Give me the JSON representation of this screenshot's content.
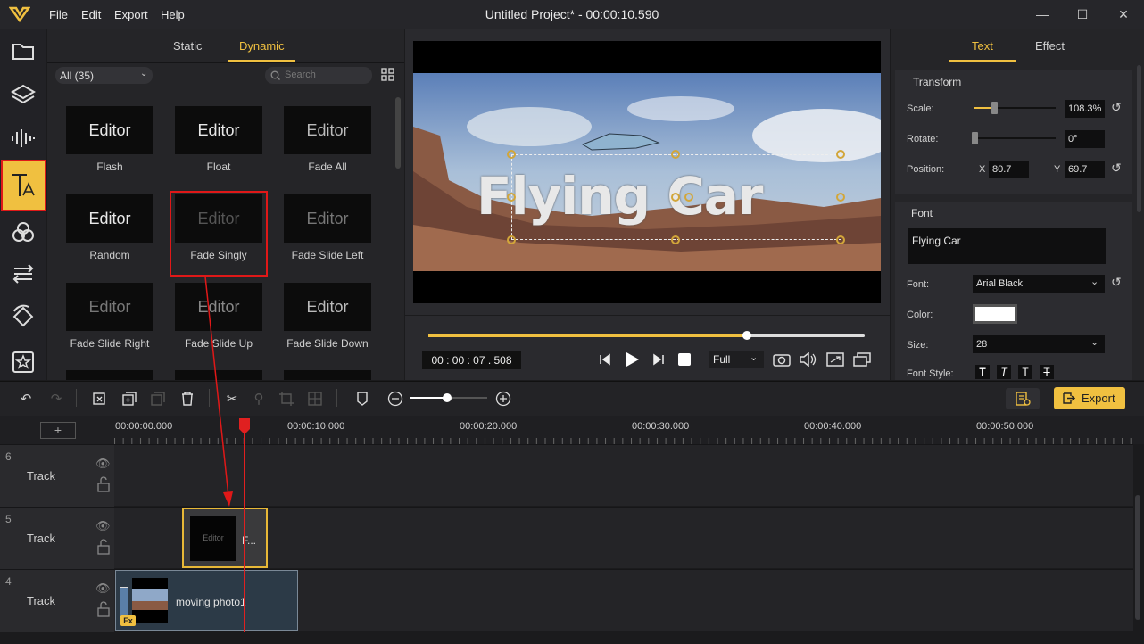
{
  "app": {
    "title": "Untitled Project* - 00:00:10.590",
    "menu": [
      "File",
      "Edit",
      "Export",
      "Help"
    ],
    "accent": "#f0c040",
    "highlight": "#e01818"
  },
  "library": {
    "tabs": [
      "Static",
      "Dynamic"
    ],
    "active_tab": "Dynamic",
    "filter": "All (35)",
    "search_placeholder": "Search",
    "items": [
      {
        "preview": "Editor",
        "label": "Flash"
      },
      {
        "preview": "Editor",
        "label": "Float"
      },
      {
        "preview": "Editor",
        "label": "Fade All"
      },
      {
        "preview": "Editor",
        "label": "Random"
      },
      {
        "preview": "Editor",
        "label": "Fade Singly"
      },
      {
        "preview": "Editor",
        "label": "Fade Slide Left"
      },
      {
        "preview": "Editor",
        "label": "Fade Slide Right"
      },
      {
        "preview": "Editor",
        "label": "Fade Slide Up"
      },
      {
        "preview": "Editor",
        "label": "Fade Slide Down"
      }
    ]
  },
  "preview": {
    "overlay_text": "Flying Car",
    "timecode": "00 : 00 : 07 . 508",
    "zoom": "Full",
    "progress": 0.73
  },
  "props": {
    "tabs": [
      "Text",
      "Effect"
    ],
    "transform": {
      "title": "Transform",
      "scale_label": "Scale:",
      "scale": "108.3%",
      "rotate_label": "Rotate:",
      "rotate": "0°",
      "position_label": "Position:",
      "x_label": "X",
      "x": "80.7",
      "y_label": "Y",
      "y": "69.7"
    },
    "font": {
      "title": "Font",
      "text": "Flying Car",
      "font_label": "Font:",
      "font": "Arial Black",
      "color_label": "Color:",
      "size_label": "Size:",
      "size": "28",
      "style_label": "Font Style:",
      "style_buttons": [
        "T",
        "T",
        "T",
        "T"
      ]
    }
  },
  "toolbar": {
    "export": "Export"
  },
  "ruler": {
    "labels": [
      "00:00:00.000",
      "00:00:10.000",
      "00:00:20.000",
      "00:00:30.000",
      "00:00:40.000",
      "00:00:50.000"
    ]
  },
  "tracks": [
    {
      "num": "6",
      "name": "Track"
    },
    {
      "num": "5",
      "name": "Track",
      "clip_preview": "Editor",
      "clip_label": "F..."
    },
    {
      "num": "4",
      "name": "Track",
      "clip_label": "moving photo1",
      "fx": "Fx"
    }
  ]
}
